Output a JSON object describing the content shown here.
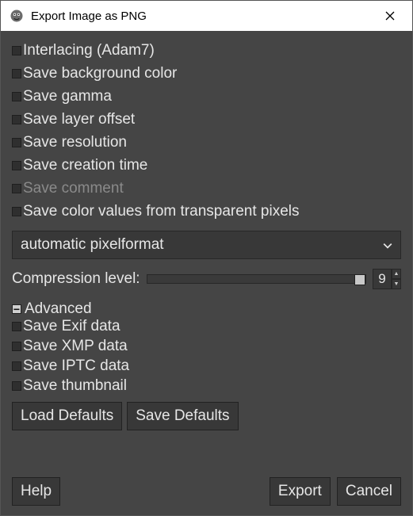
{
  "window": {
    "title": "Export Image as PNG"
  },
  "checks": {
    "interlacing": "Interlacing (Adam7)",
    "save_bg": "Save background color",
    "save_gamma": "Save gamma",
    "save_layer_offset": "Save layer offset",
    "save_resolution": "Save resolution",
    "save_ctime": "Save creation time",
    "save_comment": "Save comment",
    "save_color_trans": "Save color values from transparent pixels"
  },
  "pixelformat": {
    "selected": "automatic pixelformat"
  },
  "compression": {
    "label": "Compression level:",
    "value": "9"
  },
  "advanced": {
    "label": "Advanced",
    "exif": "Save Exif data",
    "xmp": "Save XMP data",
    "iptc": "Save IPTC data",
    "thumb": "Save thumbnail"
  },
  "buttons": {
    "load_defaults": "Load Defaults",
    "save_defaults": "Save Defaults",
    "help": "Help",
    "export": "Export",
    "cancel": "Cancel"
  }
}
